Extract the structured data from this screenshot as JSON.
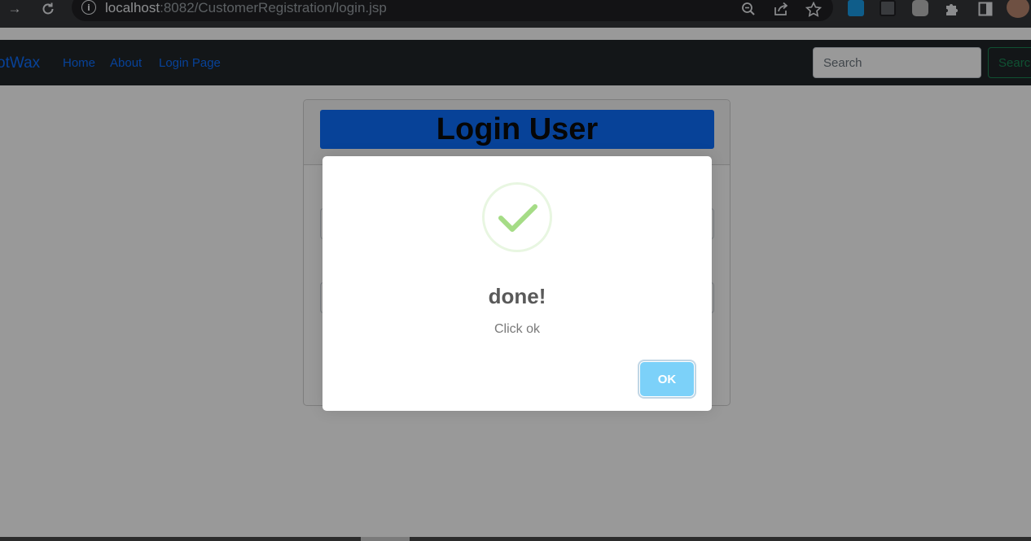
{
  "browser": {
    "url_host": "localhost",
    "url_rest": ":8082/CustomerRegistration/login.jsp",
    "icons": {
      "forward": "forward-arrow-icon",
      "reload": "reload-icon",
      "site_info": "info-icon",
      "zoom": "zoom-icon",
      "share": "share-icon",
      "bookmark": "star-icon",
      "extensions": "puzzle-icon",
      "side_panel": "side-panel-icon",
      "profile": "avatar"
    },
    "info_glyph": "i"
  },
  "navbar": {
    "brand": "otWax",
    "links": [
      "Home",
      "About",
      "Login Page"
    ],
    "search_placeholder": "Search",
    "search_button": "Search"
  },
  "card": {
    "title": "Login User"
  },
  "modal": {
    "title": "done!",
    "text": "Click ok",
    "ok_label": "OK",
    "icon": "checkmark-icon"
  },
  "colors": {
    "nav_bg": "#212529",
    "link": "#0d6efd",
    "success_button": "#198754",
    "title_bar": "#0d6efd",
    "ok_button": "#7cd1f9",
    "check": "#a5dc86"
  }
}
